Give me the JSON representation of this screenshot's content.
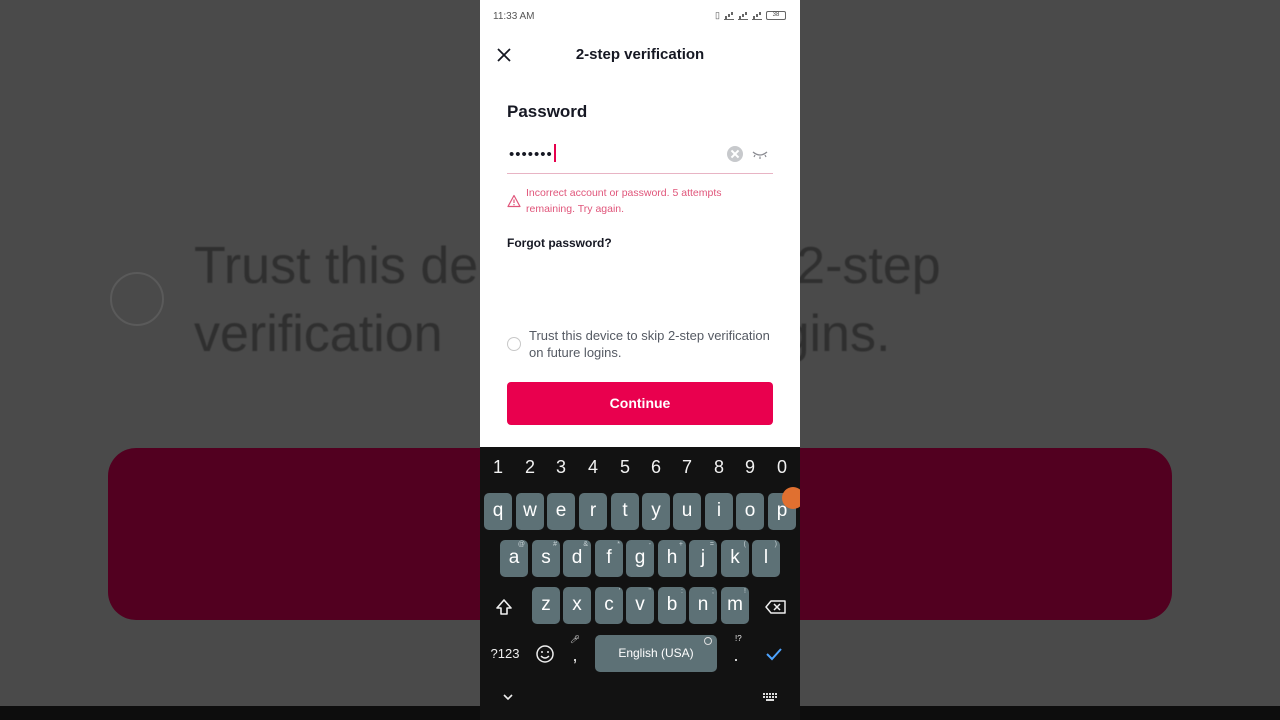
{
  "status": {
    "time": "11:33 AM",
    "battery": "38"
  },
  "header": {
    "title": "2-step verification"
  },
  "form": {
    "password_label": "Password",
    "password_value": "•••••••",
    "error": "Incorrect account or password. 5 attempts remaining. Try again.",
    "forgot": "Forgot password?",
    "trust_text": "Trust this device to skip 2-step verification on future logins.",
    "continue": "Continue"
  },
  "background": {
    "line1": "Trust this de",
    "line1b": "2-step",
    "line2": "verification",
    "line2b": "gins."
  },
  "keyboard": {
    "numbers": [
      "1",
      "2",
      "3",
      "4",
      "5",
      "6",
      "7",
      "8",
      "9",
      "0"
    ],
    "row1": [
      "q",
      "w",
      "e",
      "r",
      "t",
      "y",
      "u",
      "i",
      "o",
      "p"
    ],
    "row2": [
      "a",
      "s",
      "d",
      "f",
      "g",
      "h",
      "j",
      "k",
      "l"
    ],
    "row2_hints": [
      "@",
      "#",
      "&",
      "*",
      "-",
      "+",
      "=",
      "(",
      ")"
    ],
    "row3": [
      "z",
      "x",
      "c",
      "v",
      "b",
      "n",
      "m"
    ],
    "row3_hints": [
      "",
      "",
      "'",
      "\"",
      ":",
      ";",
      "!"
    ],
    "symbols_key": "?123",
    "comma": ",",
    "space_label": "English (USA)",
    "period": ".",
    "period_hint": "!?"
  },
  "colors": {
    "accent": "#e9004e",
    "error": "#e0557a",
    "keyboard_bg": "#121212",
    "key_bg": "#5d7176"
  }
}
